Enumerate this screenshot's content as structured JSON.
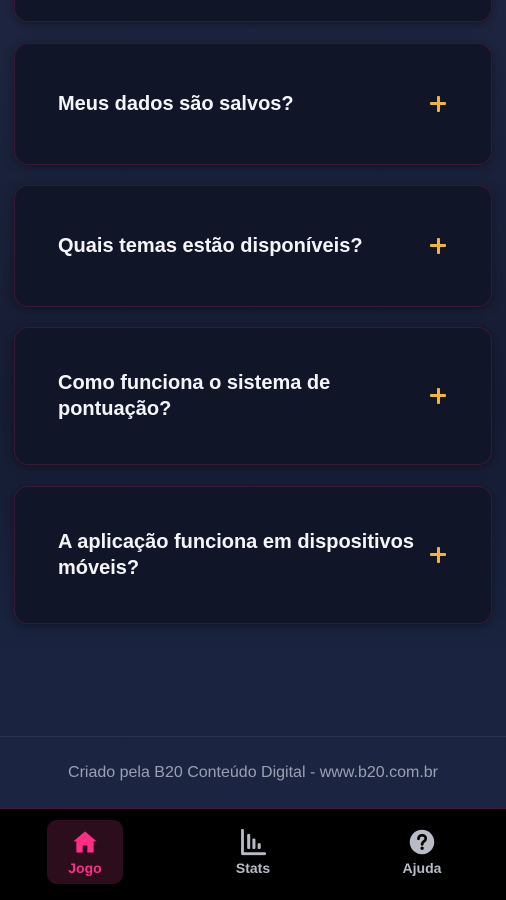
{
  "faq": {
    "items": [
      {
        "question": ""
      },
      {
        "question": "Meus dados são salvos?"
      },
      {
        "question": "Quais temas estão disponíveis?"
      },
      {
        "question": "Como funciona o sistema de pontuação?"
      },
      {
        "question": "A aplicação funciona em dispositivos móveis?"
      }
    ]
  },
  "footer": {
    "credit": "Criado pela B20 Conteúdo Digital - www.b20.com.br"
  },
  "nav": {
    "items": [
      {
        "label": "Jogo",
        "icon": "home-icon",
        "active": true
      },
      {
        "label": "Stats",
        "icon": "bar-chart-icon",
        "active": false
      },
      {
        "label": "Ajuda",
        "icon": "help-icon",
        "active": false
      }
    ]
  },
  "colors": {
    "accent": "#ff2d86",
    "toggle": "#f2b53c",
    "card_bg": "#111528",
    "card_border": "#3a1836"
  }
}
